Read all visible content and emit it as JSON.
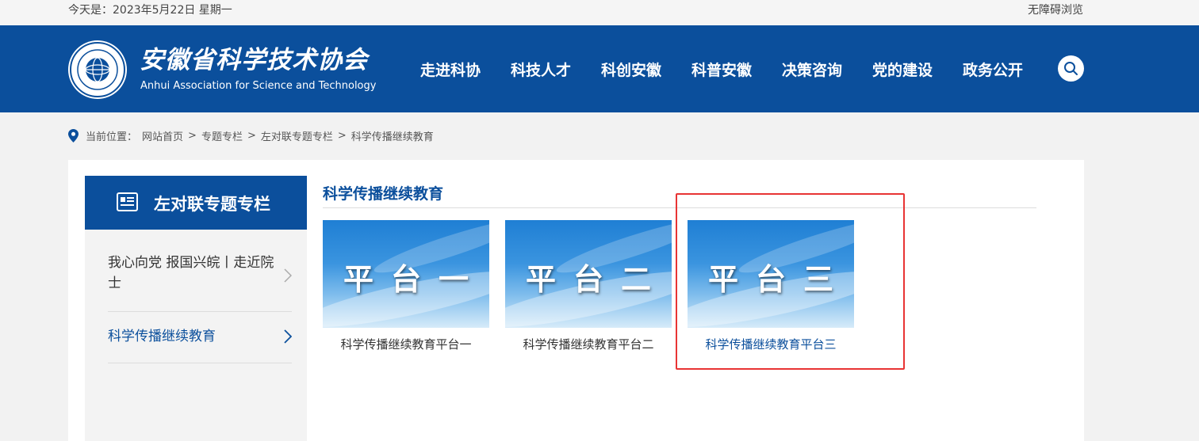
{
  "topbar": {
    "date": "今天是：2023年5月22日 星期一",
    "accessibility": "无障碍浏览"
  },
  "header": {
    "logo_cn": "安徽省科学技术协会",
    "logo_en": "Anhui Association for Science and Technology",
    "nav": [
      "走进科协",
      "科技人才",
      "科创安徽",
      "科普安徽",
      "决策咨询",
      "党的建设",
      "政务公开"
    ]
  },
  "breadcrumb": {
    "prefix": "当前位置：",
    "items": [
      "网站首页",
      "专题专栏",
      "左对联专题专栏",
      "科学传播继续教育"
    ],
    "separator": ">"
  },
  "sidebar": {
    "title": "左对联专题专栏",
    "items": [
      {
        "label": "我心向党 报国兴皖丨走近院士"
      },
      {
        "label": "科学传播继续教育"
      }
    ]
  },
  "main": {
    "title": "科学传播继续教育",
    "tiles": [
      {
        "image_text": "平台一",
        "caption": "科学传播继续教育平台一"
      },
      {
        "image_text": "平台二",
        "caption": "科学传播继续教育平台二"
      },
      {
        "image_text": "平台三",
        "caption": "科学传播继续教育平台三"
      }
    ]
  },
  "colors": {
    "brand_blue": "#0b4f9c",
    "highlight_red": "#e83434"
  }
}
